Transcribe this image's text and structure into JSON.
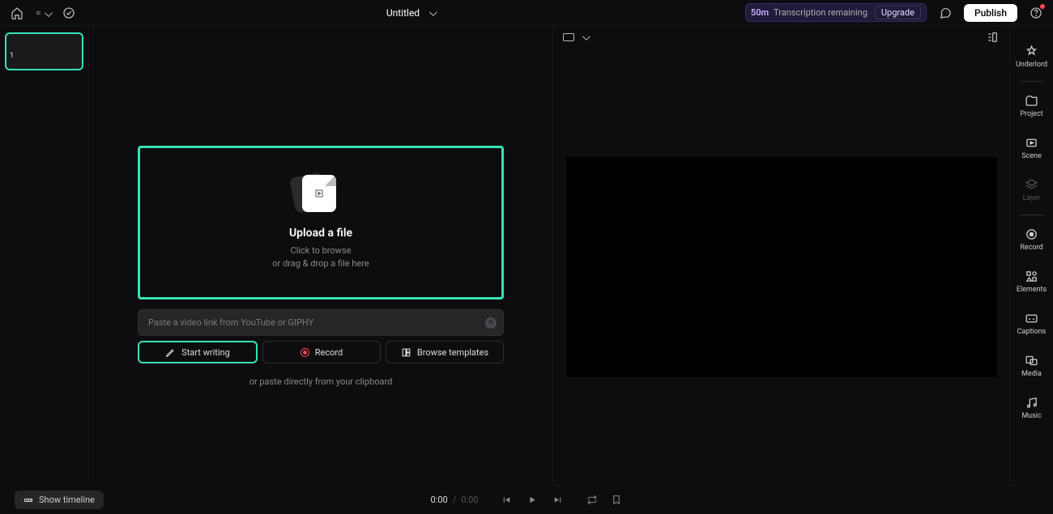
{
  "header": {
    "title": "Untitled",
    "transcription_minutes": "50m",
    "transcription_label": "Transcription remaining",
    "upgrade_label": "Upgrade",
    "publish_label": "Publish"
  },
  "scenes": {
    "first_index": "1"
  },
  "upload": {
    "title": "Upload a file",
    "line1": "Click to browse",
    "line2": "or drag & drop a file here"
  },
  "link_input": {
    "placeholder": "Paste a video link from YouTube or GIPHY"
  },
  "actions": {
    "write": "Start writing",
    "record": "Record",
    "templates": "Browse templates"
  },
  "paste_hint": "or paste directly from your clipboard",
  "sidebar": {
    "underlord": "Underlord",
    "project": "Project",
    "scene": "Scene",
    "layer": "Layer",
    "record": "Record",
    "elements": "Elements",
    "captions": "Captions",
    "media": "Media",
    "music": "Music"
  },
  "timeline": {
    "show_label": "Show timeline",
    "current": "0:00",
    "separator": "/",
    "duration": "0:00"
  }
}
